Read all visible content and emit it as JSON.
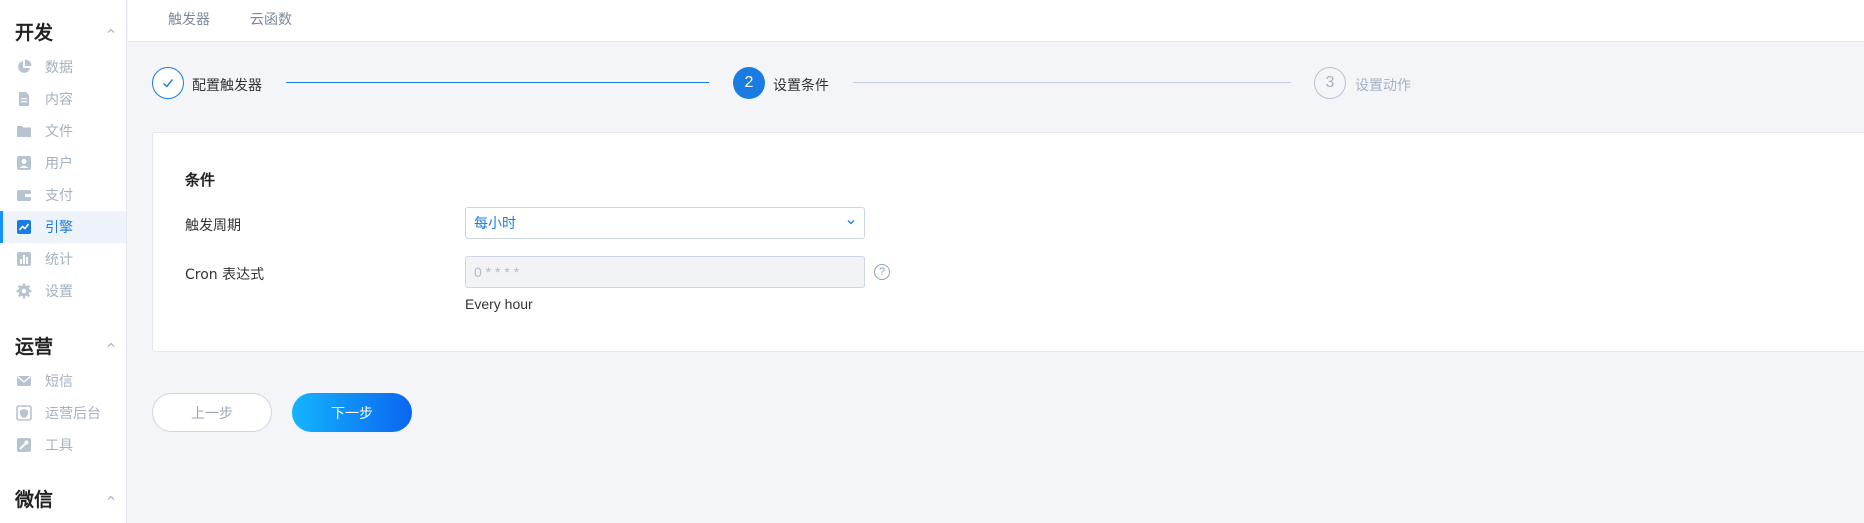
{
  "sidebar": {
    "sections": [
      {
        "title": "开发",
        "items": [
          {
            "label": "数据",
            "icon": "pie-chart-icon"
          },
          {
            "label": "内容",
            "icon": "document-icon"
          },
          {
            "label": "文件",
            "icon": "folder-icon"
          },
          {
            "label": "用户",
            "icon": "user-icon"
          },
          {
            "label": "支付",
            "icon": "wallet-icon"
          },
          {
            "label": "引擎",
            "icon": "trend-icon",
            "active": true
          },
          {
            "label": "统计",
            "icon": "bar-chart-icon"
          },
          {
            "label": "设置",
            "icon": "gear-icon"
          }
        ]
      },
      {
        "title": "运营",
        "items": [
          {
            "label": "短信",
            "icon": "mail-icon"
          },
          {
            "label": "运营后台",
            "icon": "shield-icon"
          },
          {
            "label": "工具",
            "icon": "wrench-icon"
          }
        ]
      },
      {
        "title": "微信",
        "items": []
      }
    ]
  },
  "topbar": {
    "tabs": [
      "触发器",
      "云函数"
    ]
  },
  "steps": [
    {
      "label": "配置触发器",
      "status": "done"
    },
    {
      "label": "设置条件",
      "number": "2",
      "status": "active"
    },
    {
      "label": "设置动作",
      "number": "3",
      "status": "pending"
    }
  ],
  "form": {
    "title": "条件",
    "period_label": "触发周期",
    "period_value": "每小时",
    "cron_label": "Cron 表达式",
    "cron_placeholder": "0 * * * *",
    "cron_hint": "Every hour",
    "help_glyph": "?"
  },
  "buttons": {
    "prev": "上一步",
    "next": "下一步"
  },
  "colors": {
    "accent": "#1890ff",
    "active_text": "#1a7ce0",
    "muted": "#a5b1c0"
  }
}
